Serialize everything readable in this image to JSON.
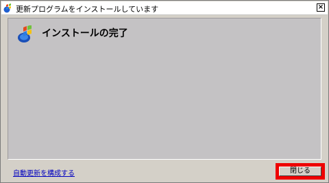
{
  "window": {
    "title": "更新プログラムをインストールしています",
    "close_glyph": "×"
  },
  "main": {
    "heading": "インストールの完了"
  },
  "footer": {
    "link_text": "自動更新を構成する",
    "close_button_label": "閉じる"
  },
  "colors": {
    "highlight": "#ee0000",
    "link": "#0000c0"
  },
  "icons": {
    "title": "windows-update-icon",
    "logo": "windows-logo-icon"
  }
}
